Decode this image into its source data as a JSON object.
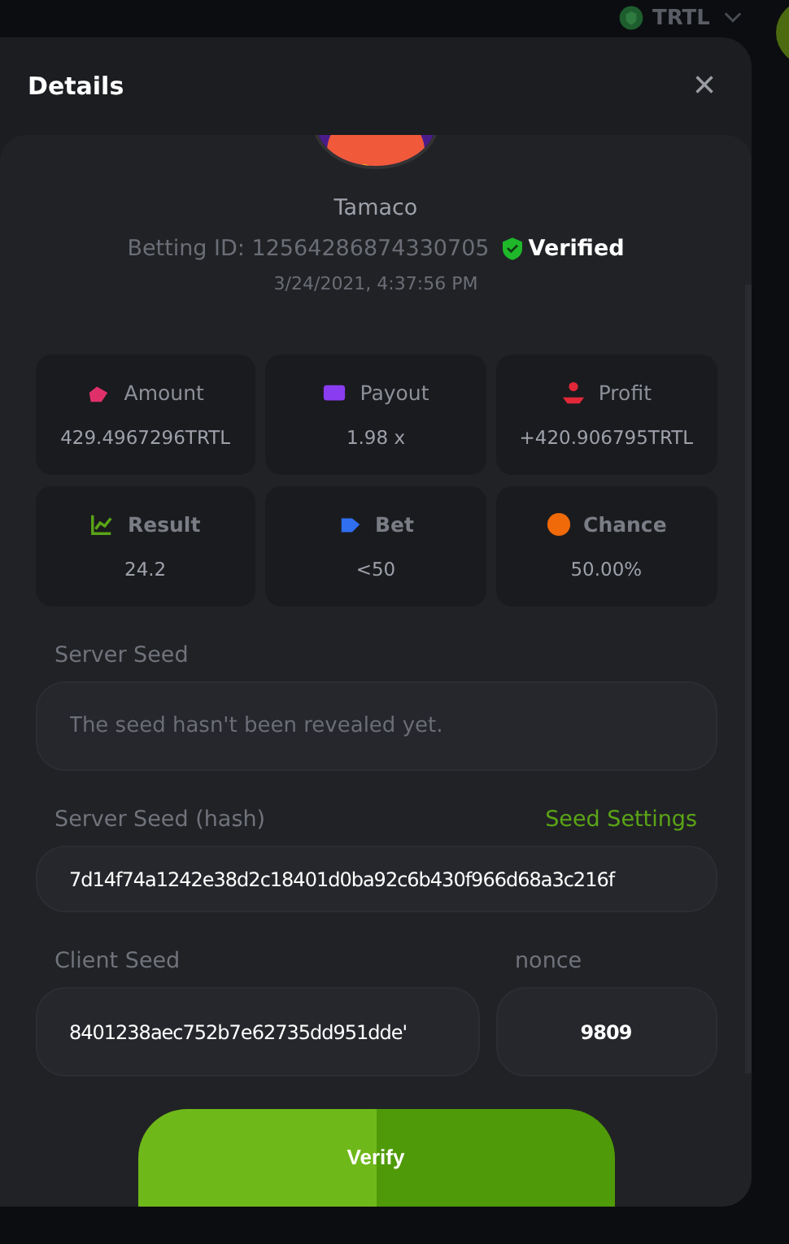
{
  "top_bar": {
    "currency": "TRTL"
  },
  "modal": {
    "title": "Details",
    "close": "×"
  },
  "user": {
    "name": "Tamaco",
    "betting_id": "Betting ID: 12564286874330705",
    "verified": true,
    "verified_label": "Verified",
    "date": "3/24/2021, 4:37:56 PM"
  },
  "stats": [
    {
      "kind": "amount",
      "label": "Amount",
      "value": "429.4967296TRTL",
      "color": "#e0306a"
    },
    {
      "kind": "payout",
      "label": "Payout",
      "value": "1.98 x",
      "color": "#8a3cf0"
    },
    {
      "kind": "profit",
      "label": "Profit",
      "value": "+420.906795TRTL",
      "color": "#e02838"
    },
    {
      "kind": "result",
      "label": "Result",
      "value": "24.2",
      "color": "#5aa516"
    },
    {
      "kind": "bet",
      "label": "Bet",
      "value": "<50",
      "color": "#2f6ff0"
    },
    {
      "kind": "chance",
      "label": "Chance",
      "value": "50.00%",
      "color": "#f06a0a"
    }
  ],
  "server_seed": {
    "label": "Server Seed",
    "placeholder": "The seed hasn't been revealed yet."
  },
  "server_seed_hash": {
    "label": "Server Seed (hash)",
    "link": "Seed Settings",
    "value": "7d14f74a1242e38d2c18401d0ba92c6b430f966d68a3c216f"
  },
  "client_seed": {
    "label": "Client Seed",
    "value": "8401238aec752b7e62735dd951dde'"
  },
  "nonce": {
    "label": "nonce",
    "value": "9809"
  },
  "verify_button": "Verify"
}
